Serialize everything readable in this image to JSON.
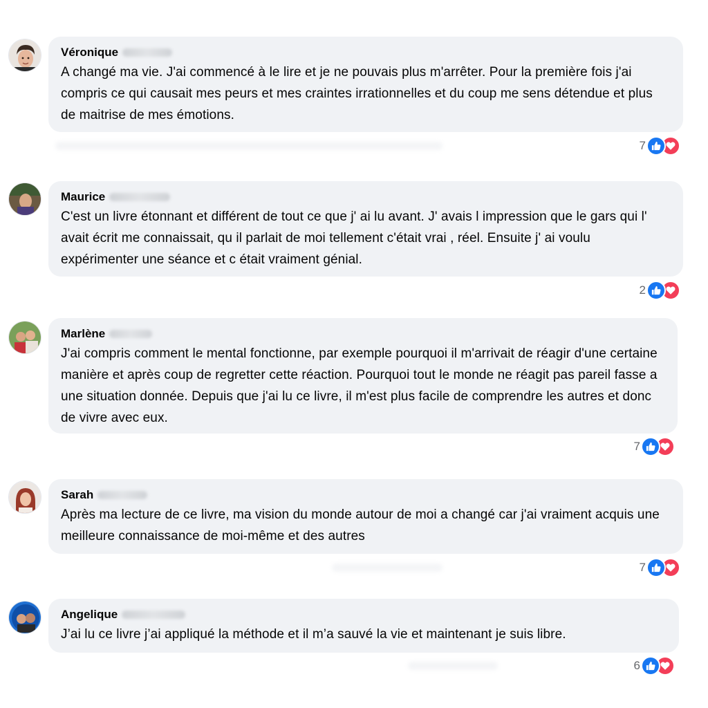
{
  "comments": [
    {
      "author": "Véronique",
      "text": "A changé ma vie. J'ai commencé à le lire et je ne pouvais plus m'arrêter. Pour la première fois j'ai compris ce qui causait mes peurs et mes craintes irrationnelles et du coup me sens détendue et plus de maitrise de mes émotions.",
      "reaction_count": "7"
    },
    {
      "author": "Maurice",
      "text": "C'est un livre étonnant et différent de tout ce que j' ai lu avant. J' avais l impression que le gars qui l' avait écrit me connaissait, qu il parlait de moi tellement c'était vrai , réel. Ensuite j' ai voulu expérimenter une séance et c était vraiment génial.",
      "reaction_count": "2"
    },
    {
      "author": "Marlène",
      "text": "J'ai compris comment le mental fonctionne, par exemple pourquoi il m'arrivait de réagir d'une certaine manière et après coup de regretter cette réaction. Pourquoi tout le monde ne réagit pas pareil fasse a une situation donnée. Depuis que j'ai lu ce livre, il m'est plus facile de comprendre les autres et donc de vivre avec eux.",
      "reaction_count": "7"
    },
    {
      "author": "Sarah",
      "text": "Après ma lecture de ce livre, ma vision du monde autour de moi a changé car j'ai vraiment acquis une meilleure connaissance de moi-même et des autres",
      "reaction_count": "7"
    },
    {
      "author": "Angelique",
      "text": "J’ai lu ce livre j’ai appliqué la méthode et il m’a sauvé la vie et maintenant je suis libre.",
      "reaction_count": "6"
    }
  ],
  "colors": {
    "bubble": "#f0f2f5",
    "like": "#1877f2",
    "love": "#f33e58",
    "muted": "#65676b"
  },
  "icons": {
    "like": "thumbs-up-icon",
    "love": "heart-icon"
  }
}
